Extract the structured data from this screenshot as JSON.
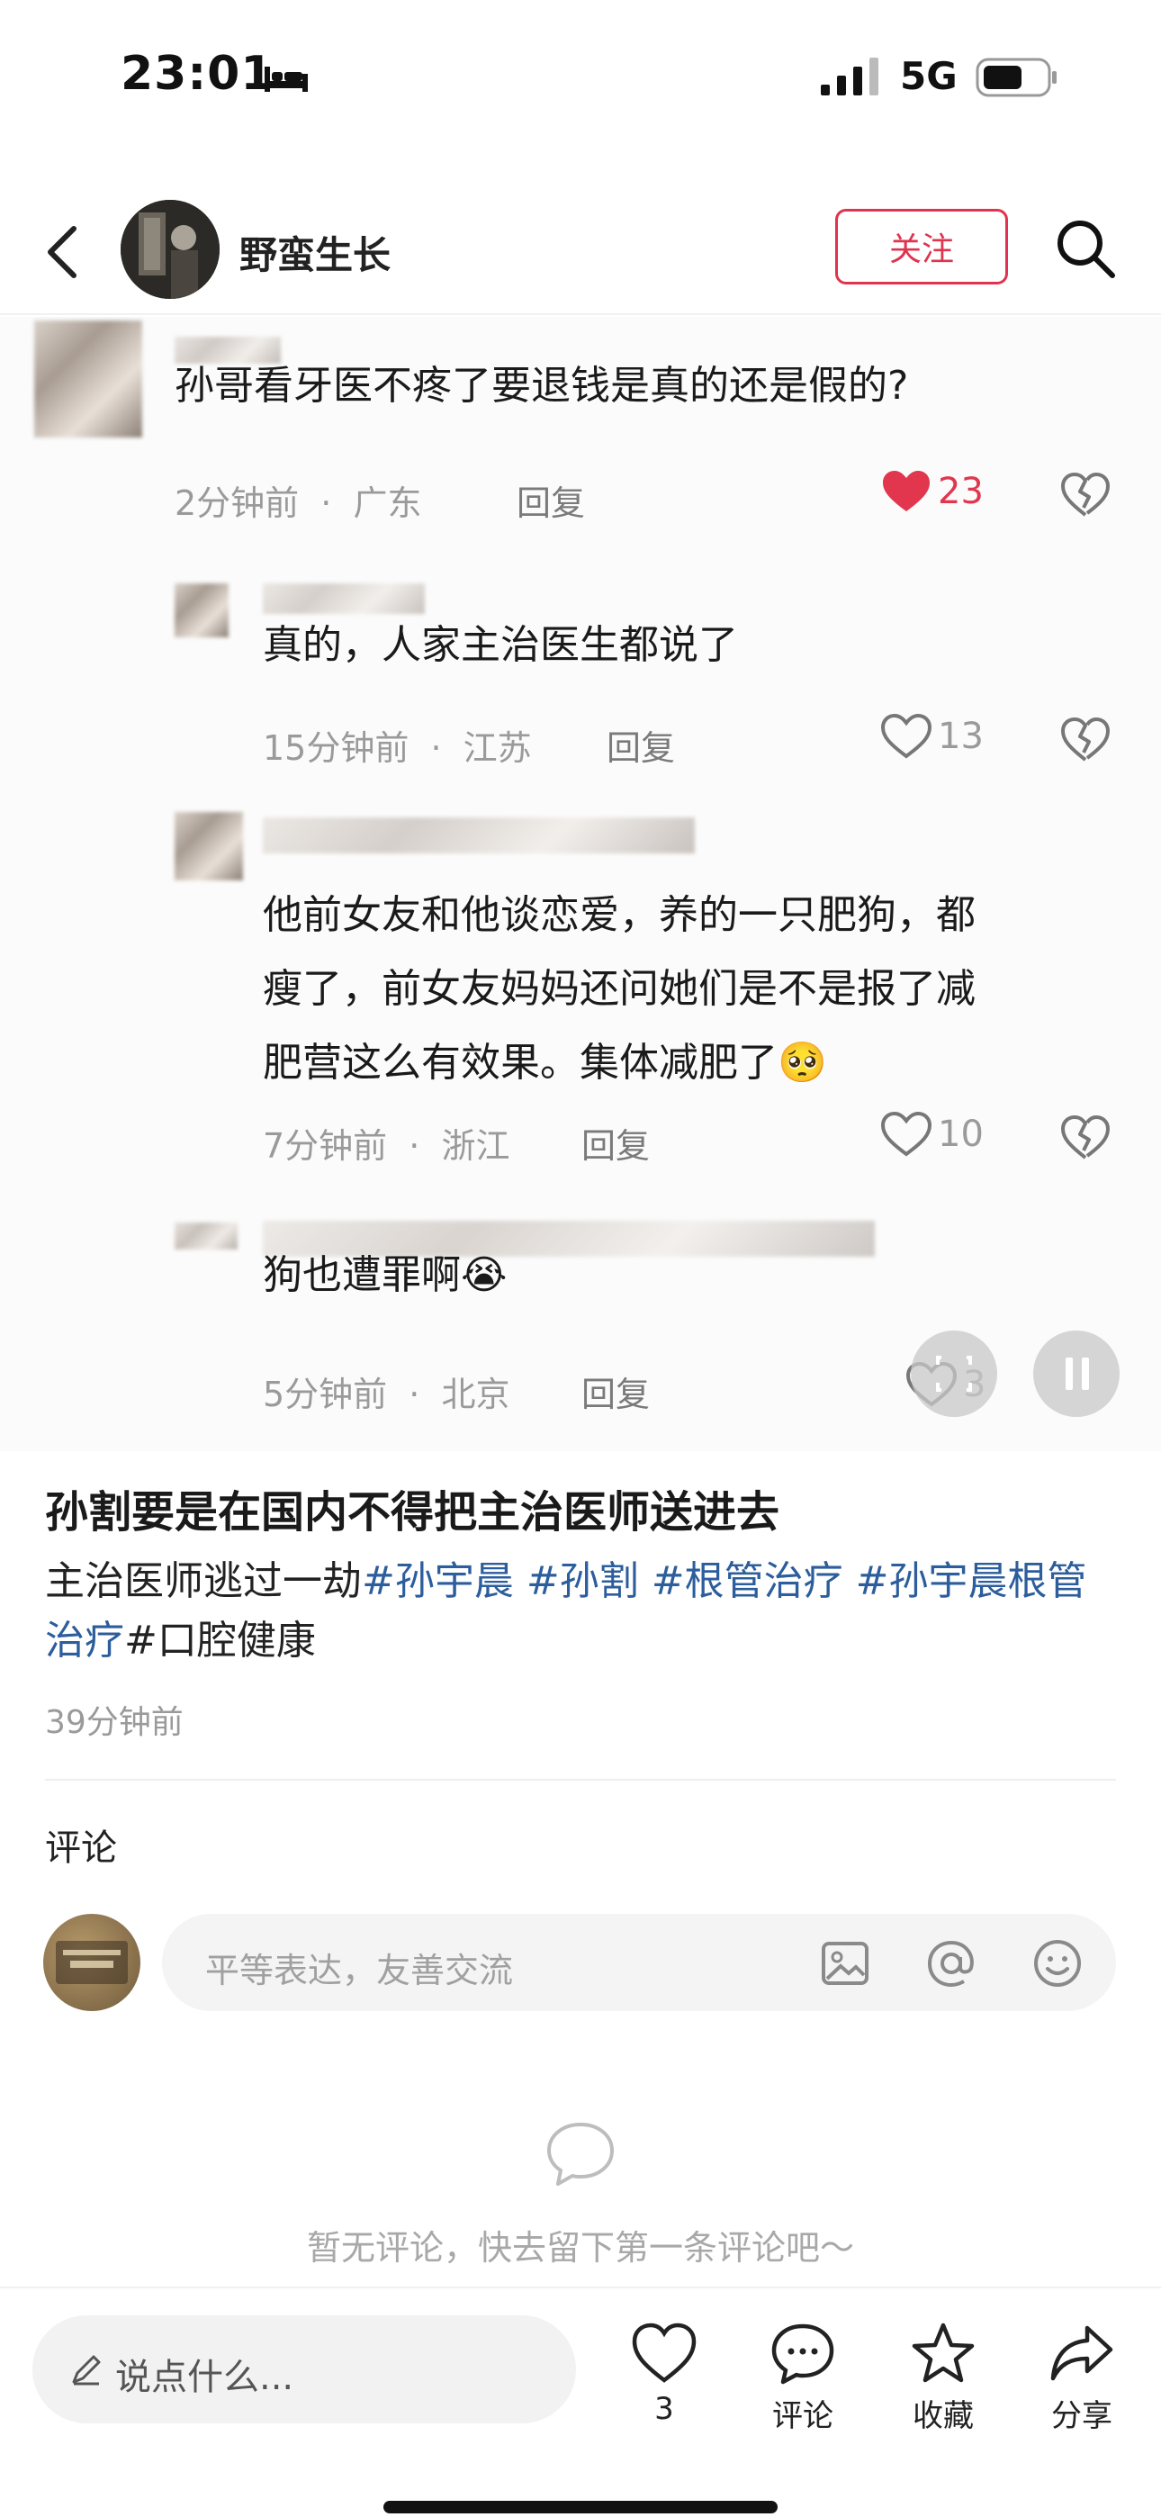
{
  "status_bar": {
    "time": "23:01",
    "network": "5G"
  },
  "header": {
    "author": "野蛮生长",
    "follow_label": "关注"
  },
  "comments": [
    {
      "text": "孙哥看牙医不疼了要退钱是真的还是假的?",
      "time": "2分钟前",
      "location": "广东",
      "reply": "回复",
      "likes": "23",
      "liked": true
    },
    {
      "text": "真的，人家主治医生都说了",
      "time": "15分钟前",
      "location": "江苏",
      "reply": "回复",
      "likes": "13",
      "liked": false
    },
    {
      "text_line1": "他前女友和他谈恋爱，养的一只肥狗，都",
      "text_line2": "瘦了，前女友妈妈还问她们是不是报了减",
      "text_line3": "肥营这么有效果。集体减肥了🥺",
      "time": "7分钟前",
      "location": "浙江",
      "reply": "回复",
      "likes": "10",
      "liked": false
    },
    {
      "text": "狗也遭罪啊😭",
      "time": "5分钟前",
      "location": "北京",
      "reply": "回复",
      "likes": "3",
      "liked": false
    }
  ],
  "meta_separator": "·",
  "post": {
    "title": "孙割要是在国内不得把主治医师送进去",
    "body_prefix": "主治医师逃过一劫",
    "tags": [
      "#孙宇晨",
      "#孙割",
      "#根管治疗",
      "#孙宇晨根管治疗"
    ],
    "body_suffix": "#口腔健康",
    "time": "39分钟前"
  },
  "comments_section": {
    "label": "评论",
    "input_placeholder": "平等表达，友善交流",
    "empty_text": "暂无评论，快去留下第一条评论吧～"
  },
  "bottom_bar": {
    "say_placeholder": "说点什么...",
    "like_count": "3",
    "comment_label": "评论",
    "collect_label": "收藏",
    "share_label": "分享"
  },
  "colors": {
    "accent": "#e0334f",
    "tag": "#2c5d9c"
  }
}
